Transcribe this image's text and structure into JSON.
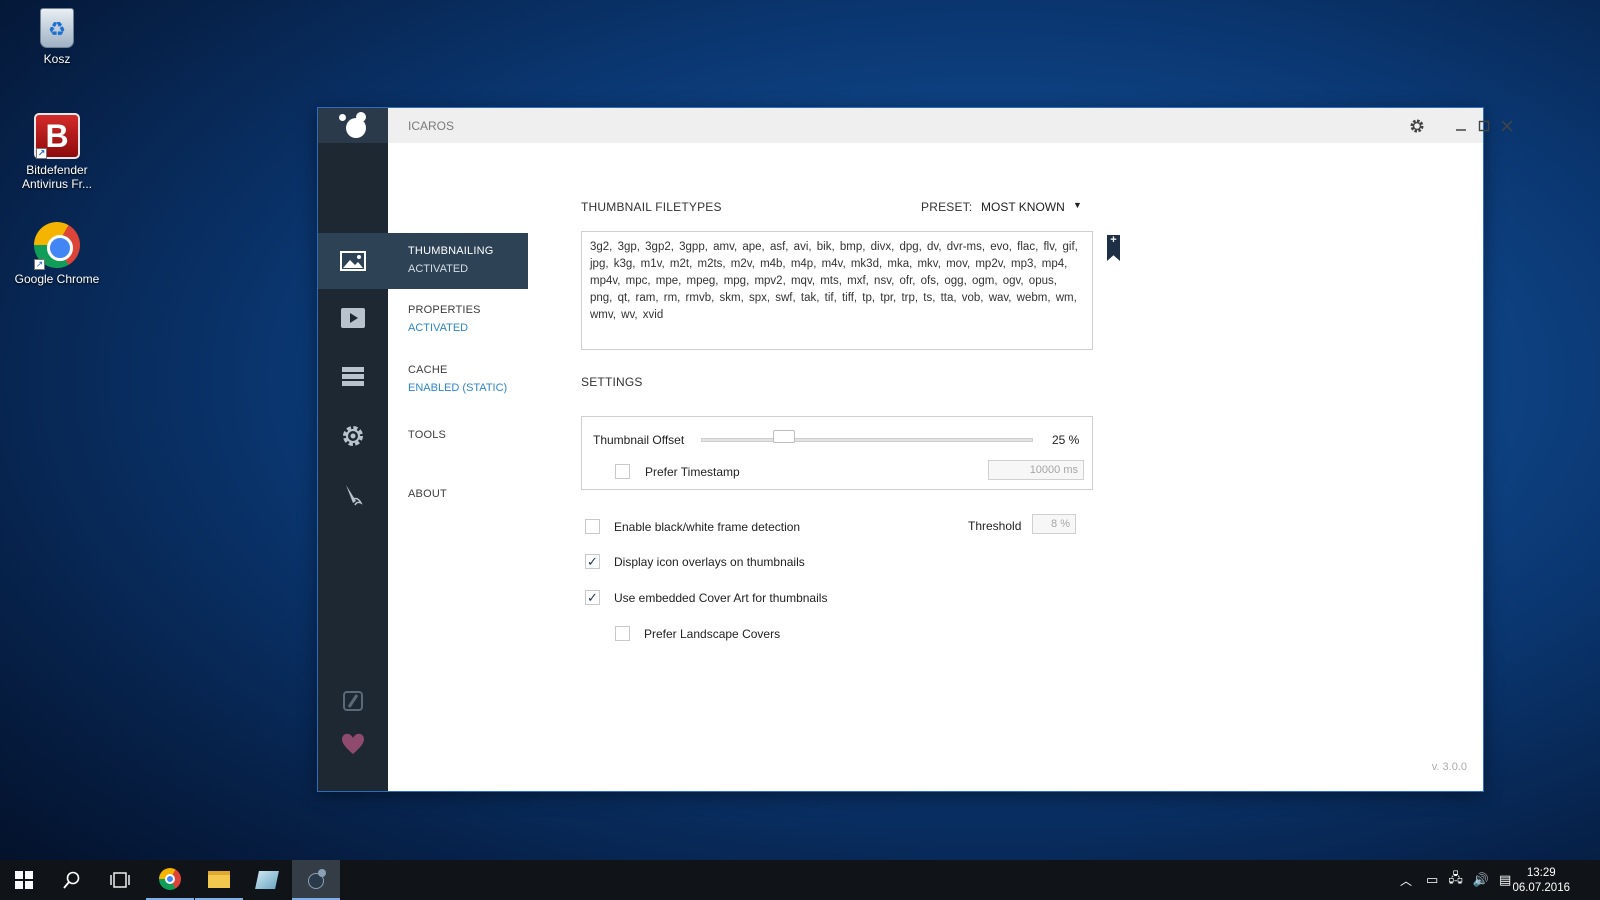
{
  "desktop": {
    "icons": [
      {
        "label": "Kosz"
      },
      {
        "label": "Bitdefender Antivirus Fr..."
      },
      {
        "label": "Google Chrome"
      }
    ]
  },
  "window": {
    "title": "ICAROS",
    "nav": [
      {
        "title": "THUMBNAILING",
        "status": "ACTIVATED"
      },
      {
        "title": "PROPERTIES",
        "status": "ACTIVATED"
      },
      {
        "title": "CACHE",
        "status": "ENABLED (STATIC)"
      },
      {
        "title": "TOOLS",
        "status": ""
      },
      {
        "title": "ABOUT",
        "status": ""
      }
    ],
    "content": {
      "filetypes_label": "THUMBNAIL FILETYPES",
      "preset_label": "PRESET:",
      "preset_value": "MOST KNOWN",
      "filetypes": "3g2, 3gp, 3gp2, 3gpp, amv, ape, asf, avi, bik, bmp, divx, dpg, dv, dvr-ms, evo, flac, flv, gif, jpg, k3g, m1v, m2t, m2ts, m2v, m4b, m4p, m4v, mk3d, mka, mkv, mov, mp2v, mp3, mp4, mp4v, mpc, mpe, mpeg, mpg, mpv2, mqv, mts, mxf, nsv, ofr, ofs, ogg, ogm, ogv, opus, png, qt, ram, rm, rmvb, skm, spx, swf, tak, tif, tiff, tp, tpr, trp, ts, tta, vob, wav, webm, wm, wmv, wv, xvid",
      "settings_label": "SETTINGS",
      "thumbnail_offset_label": "Thumbnail Offset",
      "thumbnail_offset_value": "25 %",
      "thumbnail_offset_percent": 25,
      "prefer_timestamp_label": "Prefer Timestamp",
      "prefer_timestamp_checked": false,
      "timestamp_value": "10000 ms",
      "bw_detection_label": "Enable black/white frame detection",
      "bw_detection_checked": false,
      "threshold_label": "Threshold",
      "threshold_value": "8 %",
      "icon_overlays_label": "Display icon overlays on thumbnails",
      "icon_overlays_checked": true,
      "cover_art_label": "Use embedded Cover Art for thumbnails",
      "cover_art_checked": true,
      "landscape_covers_label": "Prefer Landscape Covers",
      "landscape_covers_checked": false,
      "version": "v. 3.0.0"
    }
  },
  "taskbar": {
    "time": "13:29",
    "date": "06.07.2016"
  }
}
